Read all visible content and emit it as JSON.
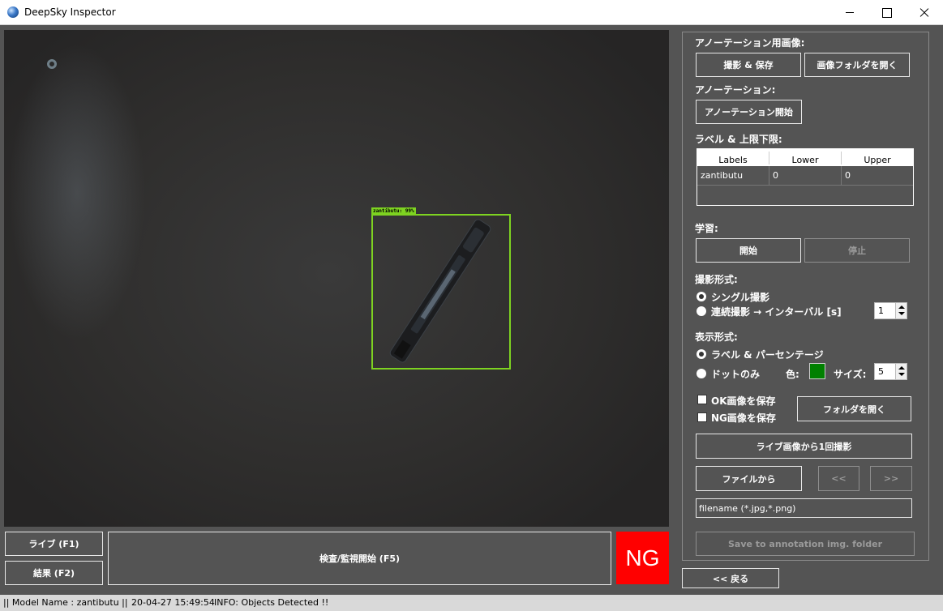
{
  "window": {
    "title": "DeepSky Inspector"
  },
  "camera": {
    "detection_label": "zantibutu: 99%"
  },
  "annotation_images": {
    "label": "アノーテーション用画像:",
    "capture_save": "撮影 & 保存",
    "open_image_folder": "画像フォルダを開く"
  },
  "annotation": {
    "label": "アノーテーション:",
    "start": "アノーテーション開始"
  },
  "limits": {
    "label": "ラベル & 上限下限:",
    "columns": [
      "Labels",
      "Lower",
      "Upper"
    ],
    "rows": [
      {
        "label": "zantibutu",
        "lower": "0",
        "upper": "0"
      }
    ]
  },
  "training": {
    "label": "学習:",
    "start": "開始",
    "stop": "停止"
  },
  "capture_mode": {
    "label": "撮影形式:",
    "single": "シングル撮影",
    "continuous": "連続撮影 → インターバル [s]",
    "interval": "1"
  },
  "display_mode": {
    "label": "表示形式:",
    "label_percentage": "ラベル & パーセンテージ",
    "dot_only": "ドットのみ",
    "color_label": "色:",
    "size_label": "サイズ:",
    "size_value": "5",
    "dot_color": "#008000"
  },
  "save_options": {
    "save_ok": "OK画像を保存",
    "save_ng": "NG画像を保存",
    "open_folder": "フォルダを開く"
  },
  "actions": {
    "capture_once": "ライブ画像から1回撮影",
    "from_file": "ファイルから",
    "prev": "<<",
    "next": ">>",
    "filename_placeholder": "filename (*.jpg,*.png)",
    "save_annotation": "Save to annotation img. folder",
    "back": "<< 戻る"
  },
  "bottom": {
    "live": "ライブ (F1)",
    "results": "結果 (F2)",
    "inspect": "検査/監視開始 (F5)",
    "verdict": "NG",
    "verdict_color": "#ff0000"
  },
  "status": {
    "model": "|| Model Name : zantibutu ||",
    "timestamp": "20-04-27 15:49:54",
    "info": "INFO:   Objects Detected !!"
  }
}
